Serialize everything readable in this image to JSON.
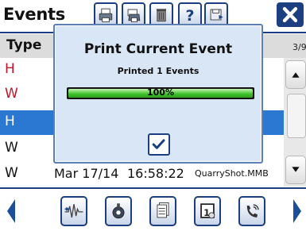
{
  "header": {
    "title": "Events"
  },
  "table": {
    "type_header": "Type",
    "page_count": "3/9",
    "rows": [
      {
        "type": "H",
        "date": "",
        "time": "",
        "file": ""
      },
      {
        "type": "W",
        "date": "",
        "time": "",
        "file": ""
      },
      {
        "type": "H",
        "date": "",
        "time": "",
        "file": ""
      },
      {
        "type": "W",
        "date": "",
        "time": "",
        "file": ""
      },
      {
        "type": "W",
        "date": "Mar 17/14",
        "time": "16:58:22",
        "file": "QuarryShot.MMB"
      }
    ]
  },
  "dialog": {
    "title": "Print Current Event",
    "message": "Printed 1 Events",
    "progress": 1.0,
    "progress_label": "100%"
  },
  "colors": {
    "accent": "#1b3f80",
    "selected_row": "#2a78d2",
    "event_red": "#c0162a",
    "progress_green": "#3bbf27",
    "dialog_bg": "#d9e6f5"
  },
  "icons": {
    "toolbar": [
      "print-icon",
      "fax-print-icon",
      "trash-icon",
      "help-icon",
      "save-icon",
      "close-icon"
    ],
    "footer": [
      "waveform-icon",
      "monitor-icon",
      "documents-icon",
      "calendar-icon",
      "phone-icon"
    ]
  }
}
